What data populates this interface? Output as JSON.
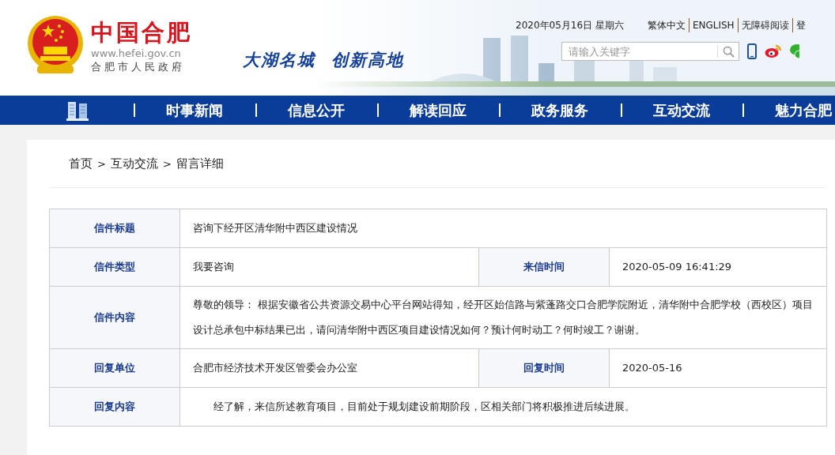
{
  "header": {
    "site_title": "中国合肥",
    "site_url": "www.hefei.gov.cn",
    "site_subtitle": "合肥市人民政府",
    "slogan": [
      "大湖名城",
      "创新高地"
    ],
    "date": "2020年05月16日 星期六",
    "top_links": [
      "繁体中文",
      "ENGLISH",
      "无障碍阅读",
      "登"
    ],
    "search": {
      "placeholder": "请输入关键字"
    }
  },
  "nav": {
    "items": [
      "时事新闻",
      "信息公开",
      "解读回应",
      "政务服务",
      "互动交流",
      "魅力合肥"
    ]
  },
  "breadcrumb": [
    "首页",
    "互动交流",
    "留言详细"
  ],
  "breadcrumb_separator": ">",
  "letter": {
    "rows": [
      {
        "fields": [
          {
            "label": "信件标题",
            "value": "咨询下经开区清华附中西区建设情况",
            "indent": false
          }
        ]
      },
      {
        "fields": [
          {
            "label": "信件类型",
            "value": "我要咨询",
            "indent": false
          },
          {
            "label": "来信时间",
            "value": "2020-05-09 16:41:29",
            "indent": false
          }
        ]
      },
      {
        "fields": [
          {
            "label": "信件内容",
            "value": "尊敬的领导： 根据安徽省公共资源交易中心平台网站得知，经开区始信路与紫蓬路交口合肥学院附近，清华附中合肥学校（西校区）项目设计总承包中标结果已出，请问清华附中西区项目建设情况如何？预计何时动工？何时竣工？谢谢。",
            "indent": false
          }
        ]
      },
      {
        "fields": [
          {
            "label": "回复单位",
            "value": "合肥市经济技术开发区管委会办公室",
            "indent": false
          },
          {
            "label": "回复时间",
            "value": "2020-05-16",
            "indent": false
          }
        ]
      },
      {
        "fields": [
          {
            "label": "回复内容",
            "value": "经了解，来信所述教育项目，目前处于规划建设前期阶段，区相关部门将积极推进后续进展。",
            "indent": true
          }
        ]
      }
    ]
  }
}
